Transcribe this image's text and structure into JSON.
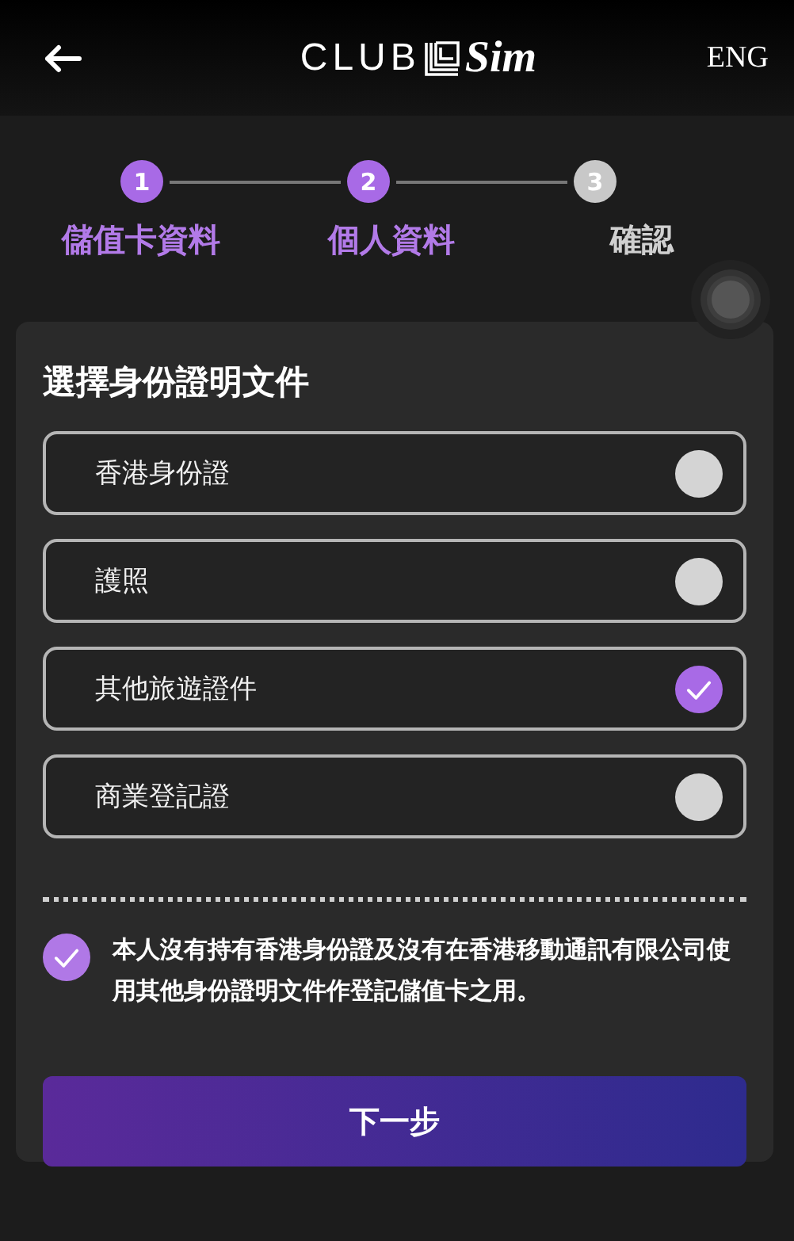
{
  "header": {
    "logo": {
      "left": "CLUB",
      "right": "Sim"
    },
    "language": "ENG"
  },
  "steps": [
    {
      "number": "1",
      "label": "儲值卡資料",
      "active": true
    },
    {
      "number": "2",
      "label": "個人資料",
      "active": true
    },
    {
      "number": "3",
      "label": "確認",
      "active": false
    }
  ],
  "card": {
    "title": "選擇身份證明文件",
    "options": [
      {
        "label": "香港身份證",
        "selected": false
      },
      {
        "label": "護照",
        "selected": false
      },
      {
        "label": "其他旅遊證件",
        "selected": true
      },
      {
        "label": "商業登記證",
        "selected": false
      }
    ],
    "declaration": {
      "text": "本人沒有持有香港身份證及沒有在香港移動通訊有限公司使用其他身份證明文件作登記儲值卡之用。",
      "checked": true
    },
    "button": "下一步"
  }
}
